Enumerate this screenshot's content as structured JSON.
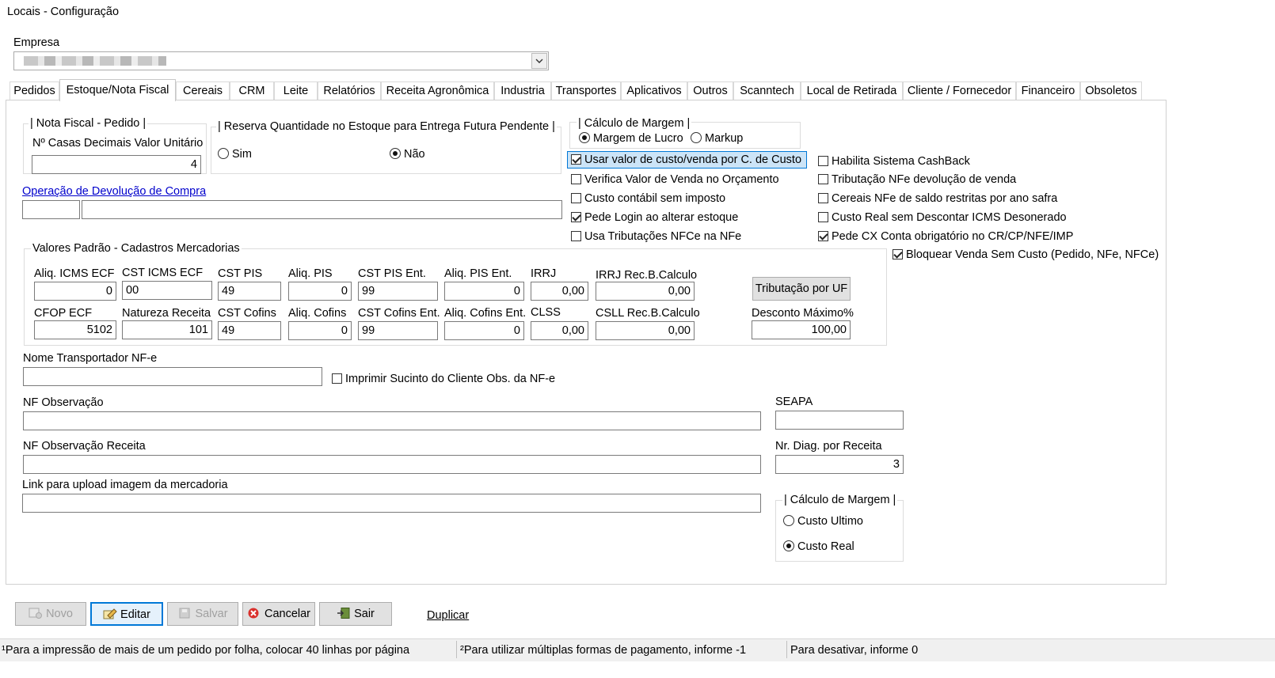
{
  "window": {
    "title": "Locais - Configuração"
  },
  "empresa": {
    "label": "Empresa",
    "value": ""
  },
  "tabs": [
    "Pedidos",
    "Estoque/Nota Fiscal",
    "Cereais",
    "CRM",
    "Leite",
    "Relatórios",
    "Receita Agronômica",
    "Industria",
    "Transportes",
    "Aplicativos",
    "Outros",
    "Scanntech",
    "Local de Retirada",
    "Cliente / Fornecedor",
    "Financeiro",
    "Obsoletos"
  ],
  "active_tab": "Estoque/Nota Fiscal",
  "nota_fiscal_pedido": {
    "legend": "| Nota Fiscal - Pedido |",
    "casas_label": "Nº Casas Decimais Valor Unitário",
    "casas_value": "4"
  },
  "reserva": {
    "legend": "| Reserva Quantidade no Estoque para Entrega Futura Pendente |",
    "sim": "Sim",
    "nao": "Não",
    "selected": "Não"
  },
  "calculo_margem_top": {
    "legend": "| Cálculo de Margem |",
    "margem_lucro": "Margem de Lucro",
    "markup": "Markup",
    "selected": "Margem de Lucro"
  },
  "operacao_devolucao": {
    "label": "Operação de Devolução de Compra",
    "code": "",
    "desc": ""
  },
  "checkboxes_left": [
    {
      "label": "Usar valor de custo/venda por C. de Custo",
      "checked": true
    },
    {
      "label": "Verifica Valor de Venda no Orçamento",
      "checked": false
    },
    {
      "label": "Custo contábil sem imposto",
      "checked": false
    },
    {
      "label": "Pede Login ao alterar estoque",
      "checked": true
    },
    {
      "label": "Usa Tributações NFCe na NFe",
      "checked": false
    }
  ],
  "checkboxes_right": [
    {
      "label": "Habilita Sistema CashBack",
      "checked": false
    },
    {
      "label": "Tributação NFe devolução de venda",
      "checked": false
    },
    {
      "label": "Cereais NFe de saldo restritas por ano safra",
      "checked": false
    },
    {
      "label": "Custo Real sem Descontar ICMS Desonerado",
      "checked": false
    },
    {
      "label": "Pede CX Conta obrigatório no CR/CP/NFE/IMP",
      "checked": true
    },
    {
      "label": "Bloquear Venda Sem Custo (Pedido, NFe, NFCe)",
      "checked": true
    }
  ],
  "valores_padrao": {
    "legend": "Valores Padrão - Cadastros Mercadorias",
    "aliq_icms_ecf": {
      "label": "Aliq. ICMS ECF",
      "value": "0"
    },
    "cst_icms_ecf": {
      "label": "CST ICMS ECF",
      "value": "00"
    },
    "cst_pis": {
      "label": "CST PIS",
      "value": "49"
    },
    "aliq_pis": {
      "label": "Aliq. PIS",
      "value": "0"
    },
    "cst_pis_ent": {
      "label": "CST PIS Ent.",
      "value": "99"
    },
    "aliq_pis_ent": {
      "label": "Aliq. PIS Ent.",
      "value": "0"
    },
    "irrj": {
      "label": "IRRJ",
      "value": "0,00"
    },
    "irrj_rec": {
      "label": "IRRJ Rec.B.Calculo",
      "value": "0,00"
    },
    "cfop_ecf": {
      "label": "CFOP ECF",
      "value": "5102"
    },
    "natureza_receita": {
      "label": "Natureza Receita",
      "value": "101"
    },
    "cst_cofins": {
      "label": "CST Cofins",
      "value": "49"
    },
    "aliq_cofins": {
      "label": "Aliq. Cofins",
      "value": "0"
    },
    "cst_cofins_ent": {
      "label": "CST Cofins Ent.",
      "value": "99"
    },
    "aliq_cofins_ent": {
      "label": "Aliq. Cofins Ent.",
      "value": "0"
    },
    "clss": {
      "label": "CLSS",
      "value": "0,00"
    },
    "csll_rec": {
      "label": "CSLL Rec.B.Calculo",
      "value": "0,00"
    },
    "tributacao_uf_button": "Tributação por UF",
    "desconto_maximo": {
      "label": "Desconto Máximo%",
      "value": "100,00"
    }
  },
  "nome_transportador": {
    "label": "Nome Transportador NF-e",
    "value": ""
  },
  "imprimir_sucinto": {
    "label": "Imprimir Sucinto do Cliente Obs. da NF-e",
    "checked": false
  },
  "nf_observacao": {
    "label": "NF Observação",
    "value": ""
  },
  "seapa": {
    "label": "SEAPA",
    "value": ""
  },
  "nf_observacao_receita": {
    "label": "NF Observação Receita",
    "value": ""
  },
  "nr_diag_receita": {
    "label": "Nr. Diag. por Receita",
    "value": "3"
  },
  "link_upload": {
    "label": "Link para upload imagem da mercadoria",
    "value": ""
  },
  "calculo_margem_bottom": {
    "legend": "| Cálculo de Margem |",
    "custo_ultimo": "Custo Ultimo",
    "custo_real": "Custo Real",
    "selected": "Custo Real"
  },
  "toolbar": {
    "novo": "Novo",
    "editar": "Editar",
    "salvar": "Salvar",
    "cancelar": "Cancelar",
    "sair": "Sair",
    "duplicar": "Duplicar"
  },
  "statusbar": {
    "note1": "¹Para a impressão de mais de um pedido por folha, colocar 40 linhas por página",
    "note2": "²Para utilizar múltiplas formas de pagamento, informe -1",
    "note3": "Para desativar, informe 0"
  },
  "colors": {
    "link": "#0000cc",
    "selection": "#cce4f7",
    "selection_border": "#0078d7",
    "button_face": "#e1e1e1",
    "statusbar_bg": "#f0f0f0",
    "cancel_icon": "#d9302c"
  }
}
